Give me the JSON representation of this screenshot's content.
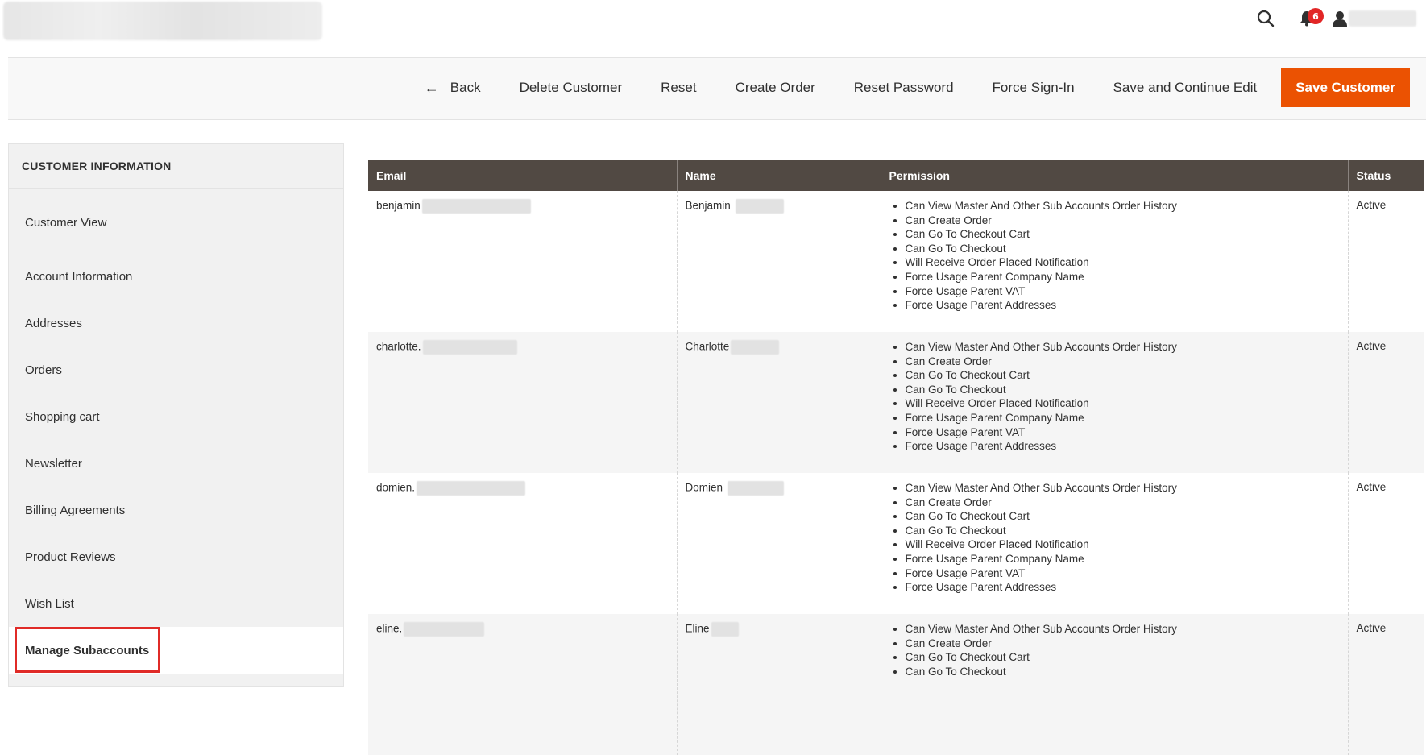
{
  "header": {
    "notification_count": "6"
  },
  "actions": {
    "back": "Back",
    "delete": "Delete Customer",
    "reset": "Reset",
    "create_order": "Create Order",
    "reset_password": "Reset Password",
    "force_signin": "Force Sign-In",
    "save_continue": "Save and Continue Edit",
    "save": "Save Customer"
  },
  "sidebar": {
    "title": "CUSTOMER INFORMATION",
    "items": [
      {
        "label": "Customer View"
      },
      {
        "label": "Account Information"
      },
      {
        "label": "Addresses"
      },
      {
        "label": "Orders"
      },
      {
        "label": "Shopping cart"
      },
      {
        "label": "Newsletter"
      },
      {
        "label": "Billing Agreements"
      },
      {
        "label": "Product Reviews"
      },
      {
        "label": "Wish List"
      }
    ],
    "active": {
      "label": "Manage Subaccounts"
    }
  },
  "table": {
    "headers": [
      "Email",
      "Name",
      "Permission",
      "Status"
    ],
    "rows": [
      {
        "email": "benjamin",
        "name": "Benjamin",
        "status": "Active",
        "permissions": [
          "Can View Master And Other Sub Accounts Order History",
          "Can Create Order",
          "Can Go To Checkout Cart",
          "Can Go To Checkout",
          "Will Receive Order Placed Notification",
          "Force Usage Parent Company Name",
          "Force Usage Parent VAT",
          "Force Usage Parent Addresses"
        ]
      },
      {
        "email": "charlotte.",
        "name": "Charlotte",
        "status": "Active",
        "permissions": [
          "Can View Master And Other Sub Accounts Order History",
          "Can Create Order",
          "Can Go To Checkout Cart",
          "Can Go To Checkout",
          "Will Receive Order Placed Notification",
          "Force Usage Parent Company Name",
          "Force Usage Parent VAT",
          "Force Usage Parent Addresses"
        ]
      },
      {
        "email": "domien.",
        "name": "Domien",
        "status": "Active",
        "permissions": [
          "Can View Master And Other Sub Accounts Order History",
          "Can Create Order",
          "Can Go To Checkout Cart",
          "Can Go To Checkout",
          "Will Receive Order Placed Notification",
          "Force Usage Parent Company Name",
          "Force Usage Parent VAT",
          "Force Usage Parent Addresses"
        ]
      },
      {
        "email": "eline.",
        "name": "Eline",
        "status": "Active",
        "permissions": [
          "Can View Master And Other Sub Accounts Order History",
          "Can Create Order",
          "Can Go To Checkout Cart",
          "Can Go To Checkout"
        ]
      }
    ]
  },
  "colors": {
    "primary": "#eb5202",
    "header_bg": "#514943",
    "highlight": "#e02b27",
    "badge": "#e22626"
  },
  "icons": {
    "search": "search-icon",
    "notifications": "bell-icon",
    "account": "user-icon",
    "back": "arrow-left-icon"
  }
}
